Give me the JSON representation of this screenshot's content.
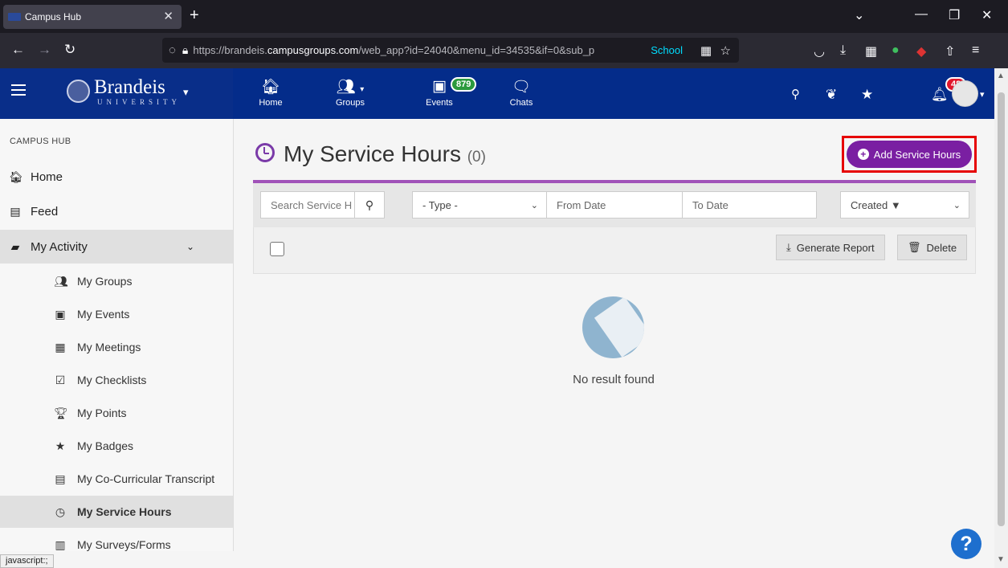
{
  "browser": {
    "tab_title": "Campus Hub",
    "url_scheme": "https://brandeis.",
    "url_host": "campusgroups.com",
    "url_path": "/web_app?id=24040&menu_id=34535&if=0&sub_p",
    "url_badge": "School"
  },
  "header": {
    "brand": "Brandeis",
    "brand_sub": "UNIVERSITY",
    "nav": [
      {
        "label": "Home",
        "icon": "home-icon"
      },
      {
        "label": "Groups",
        "icon": "groups-icon"
      },
      {
        "label": "Events",
        "icon": "calendar-icon",
        "badge": "879"
      },
      {
        "label": "Chats",
        "icon": "chat-icon"
      }
    ],
    "notifications_badge": "48"
  },
  "sidebar": {
    "section": "CAMPUS HUB",
    "items": [
      {
        "label": "Home",
        "icon": "home-icon"
      },
      {
        "label": "Feed",
        "icon": "feed-icon"
      },
      {
        "label": "My Activity",
        "icon": "activity-icon"
      }
    ],
    "subitems": [
      {
        "label": "My Groups",
        "icon": "groups-icon"
      },
      {
        "label": "My Events",
        "icon": "calendar-icon"
      },
      {
        "label": "My Meetings",
        "icon": "meetings-icon"
      },
      {
        "label": "My Checklists",
        "icon": "checklist-icon"
      },
      {
        "label": "My Points",
        "icon": "trophy-icon"
      },
      {
        "label": "My Badges",
        "icon": "badge-icon"
      },
      {
        "label": "My Co-Curricular Transcript",
        "icon": "transcript-icon"
      },
      {
        "label": "My Service Hours",
        "icon": "clock-icon"
      },
      {
        "label": "My Surveys/Forms",
        "icon": "clipboard-icon"
      }
    ]
  },
  "main": {
    "title": "My Service Hours",
    "count": "(0)",
    "add_button": "Add Service Hours",
    "filters": {
      "search_placeholder": "Search Service H",
      "type": "- Type -",
      "from_date": "From Date",
      "to_date": "To Date",
      "sort": "Created ▼"
    },
    "actions": {
      "generate_report": "Generate Report",
      "delete": "Delete"
    },
    "empty_message": "No result found"
  },
  "status_text": "javascript:;",
  "colors": {
    "header_blue": "#042c8a",
    "accent_purple": "#7a1fa2",
    "highlight_red": "#e60000"
  }
}
